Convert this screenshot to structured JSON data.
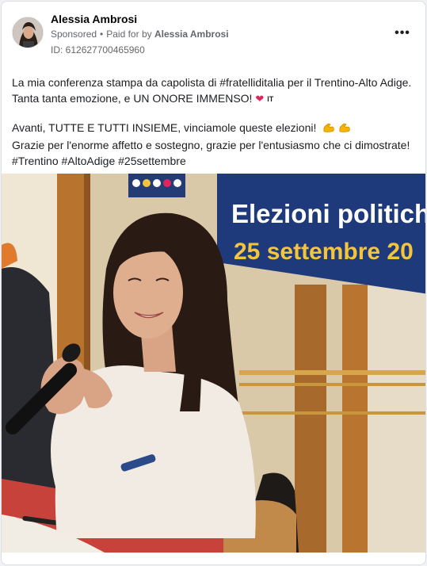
{
  "post": {
    "author": "Alessia Ambrosi",
    "sponsored": "Sponsored",
    "sep": "•",
    "paid_for_by_prefix": "Paid for by",
    "paid_for_by": "Alessia Ambrosi",
    "ad_id": "ID: 612627700465960",
    "more_label": "•••",
    "text_lines": [
      "La mia conferenza stampa da capolista di #fratelliditalia per il Trentino-Alto Adige.",
      "Tanta tanta emozione, e UN ONORE IMMENSO!",
      "Avanti, TUTTE E TUTTI INSIEME, vinciamole queste elezioni!",
      "Grazie per l'enorme affetto e sostegno, grazie per l'entusiasmo che ci dimostrate!",
      "#Trentino #AltoAdige #25settembre"
    ],
    "heart": "❤",
    "lang_flag": "IT"
  },
  "photo": {
    "banner_line1": "Elezioni politiche",
    "banner_line2": "25 settembre 20",
    "icons": {
      "avatar": "avatar-icon",
      "more": "more-dots-icon",
      "heart": "heart-icon",
      "muscle": "flexed-biceps-icon"
    }
  },
  "colors": {
    "banner_blue": "#1f3a7a",
    "banner_yellow": "#f3c53d",
    "link_text": "#1c1e21",
    "meta_gray": "#65676b"
  }
}
